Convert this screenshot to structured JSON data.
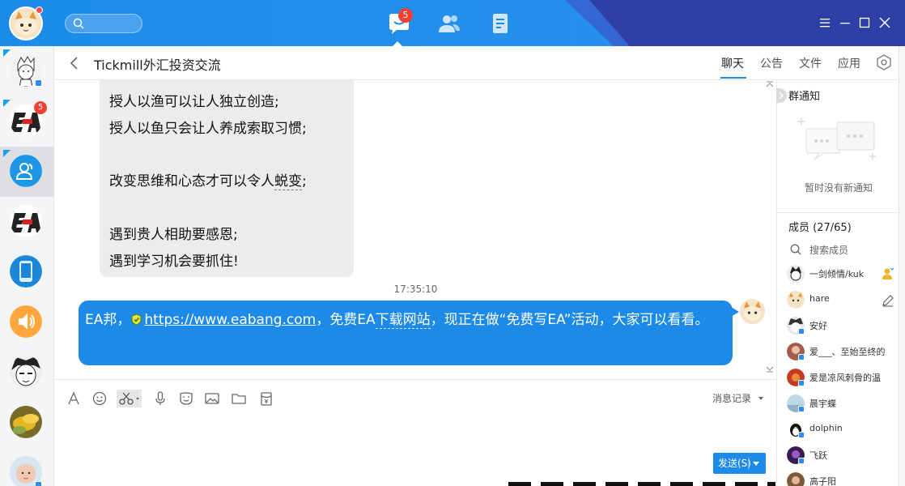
{
  "topbar": {
    "search_placeholder": "",
    "message_badge": "5",
    "accent": "#1b8bea"
  },
  "sidebar": {
    "items": [
      {
        "name": "sketch-boy-avatar",
        "badge": "",
        "active": false
      },
      {
        "name": "ea-logo-avatar",
        "badge": "5",
        "active": false
      },
      {
        "name": "group-blue-avatar",
        "badge": "",
        "active": true
      },
      {
        "name": "ea-logo-avatar-2",
        "badge": "",
        "active": false
      },
      {
        "name": "phone-blue-avatar",
        "badge": "",
        "active": false
      },
      {
        "name": "speaker-orange-avatar",
        "badge": "",
        "active": false
      },
      {
        "name": "manga-face-avatar",
        "badge": "",
        "active": false
      },
      {
        "name": "fruit-avatar",
        "badge": "",
        "active": false
      },
      {
        "name": "baby-avatar",
        "badge": "",
        "active": false
      }
    ]
  },
  "header": {
    "title": "Tickmill外汇投资交流",
    "tabs": [
      {
        "label": "聊天",
        "active": true
      },
      {
        "label": "公告",
        "active": false
      },
      {
        "label": "文件",
        "active": false
      },
      {
        "label": "应用",
        "active": false
      }
    ]
  },
  "chat": {
    "incoming_lines": [
      "授人以渔可以让人独立创造;",
      "授人以鱼只会让人养成索取习惯;",
      "",
      "改变思维和心态才可以令人",
      "",
      "遇到贵人相助要感恩;",
      "遇到学习机会要抓住!"
    ],
    "incoming_dotted_word": "蜕变",
    "incoming_dotted_tail": ";",
    "timestamp": "17:35:10",
    "outgoing": {
      "prefix": "EA邦，",
      "link": "https://www.eabang.com",
      "mid": "，免费EA",
      "dotted": "下载网站",
      "suffix": "，现正在做“免费写EA”活动，大家可以看看。"
    }
  },
  "input": {
    "history_label": "消息记录",
    "send_label": "发送(S)"
  },
  "right_panel": {
    "notice_title": "群通知",
    "notice_empty": "暂时没有新通知",
    "members_title": "成员 (27/65)",
    "member_search_placeholder": "搜索成员",
    "members": [
      {
        "name": "一剑倾情/kuk",
        "avatar": "sketch"
      },
      {
        "name": "hare",
        "avatar": "cat"
      },
      {
        "name": "安好",
        "avatar": "dark"
      },
      {
        "name": "爱___、至始至终的",
        "avatar": "red"
      },
      {
        "name": "爱是凉风刺骨的温",
        "avatar": "redorange"
      },
      {
        "name": "晨宇蝶",
        "avatar": "sky"
      },
      {
        "name": "dolphin",
        "avatar": "penguin"
      },
      {
        "name": "飞跃",
        "avatar": "purple"
      },
      {
        "name": "高子阳",
        "avatar": "brown"
      }
    ]
  }
}
